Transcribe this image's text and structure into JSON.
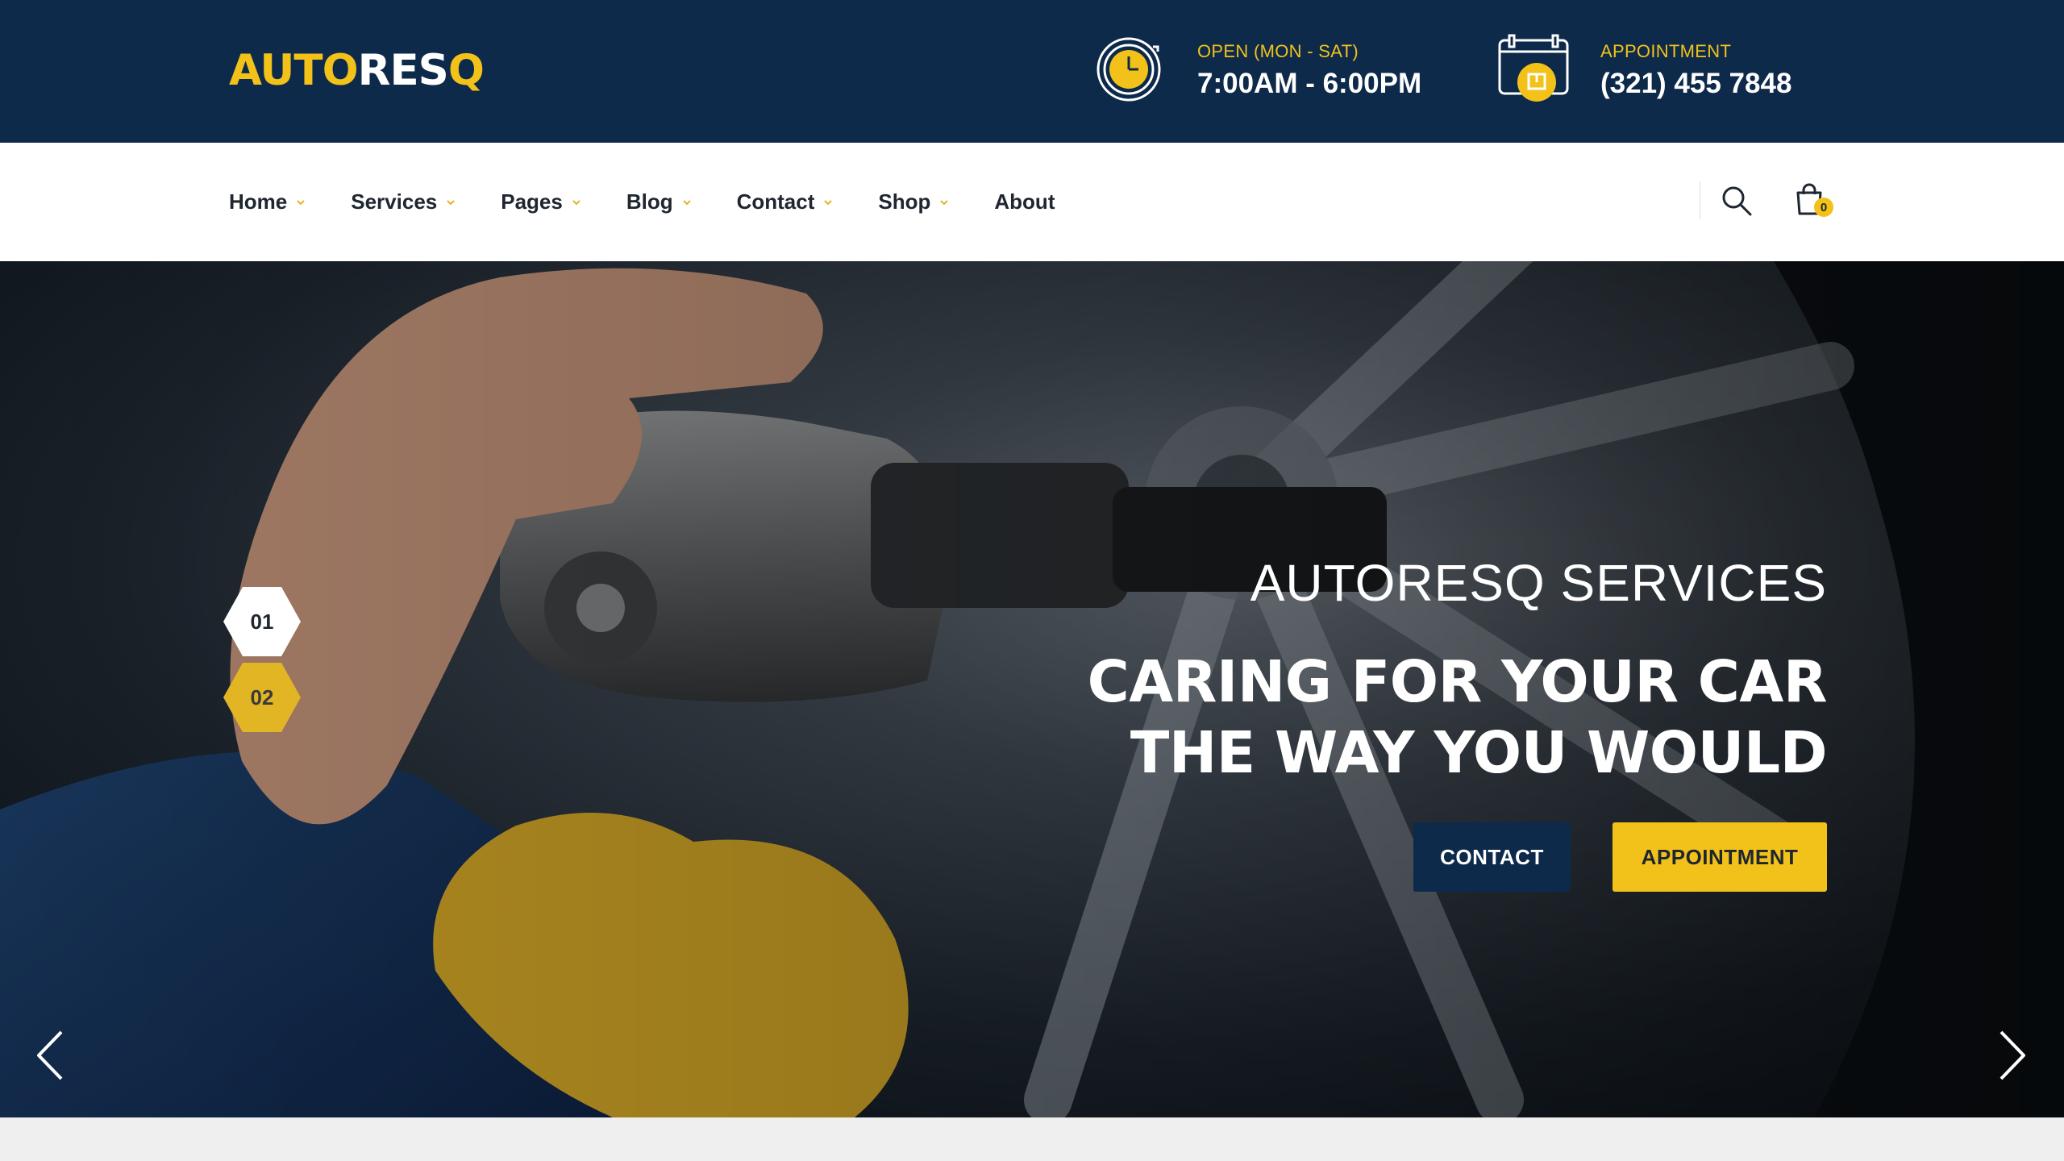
{
  "brand": {
    "logo_part1": "AUTO",
    "logo_part2": "RES",
    "logo_part3": "Q",
    "accent_color": "#f2c21a",
    "navy_color": "#0d2a4b"
  },
  "header": {
    "hours": {
      "icon": "clock-icon",
      "label": "OPEN (MON - SAT)",
      "value": "7:00AM - 6:00PM"
    },
    "appointment": {
      "icon": "calendar-icon",
      "label": "APPOINTMENT",
      "value": "(321) 455 7848"
    }
  },
  "nav": {
    "items": [
      {
        "label": "Home",
        "has_dropdown": true
      },
      {
        "label": "Services",
        "has_dropdown": true
      },
      {
        "label": "Pages",
        "has_dropdown": true
      },
      {
        "label": "Blog",
        "has_dropdown": true
      },
      {
        "label": "Contact",
        "has_dropdown": true
      },
      {
        "label": "Shop",
        "has_dropdown": true
      },
      {
        "label": "About",
        "has_dropdown": false
      }
    ],
    "search_icon": "search-icon",
    "cart_icon": "shopping-bag-icon",
    "cart_count": "0"
  },
  "hero": {
    "slides": [
      "01",
      "02"
    ],
    "active_slide": "01",
    "subtitle": "AUTORESQ SERVICES",
    "title_line1": "CARING FOR YOUR CAR",
    "title_line2": "THE WAY YOU WOULD",
    "buttons": {
      "contact": "CONTACT",
      "appointment": "APPOINTMENT"
    },
    "prev_icon": "chevron-left-icon",
    "next_icon": "chevron-right-icon"
  }
}
